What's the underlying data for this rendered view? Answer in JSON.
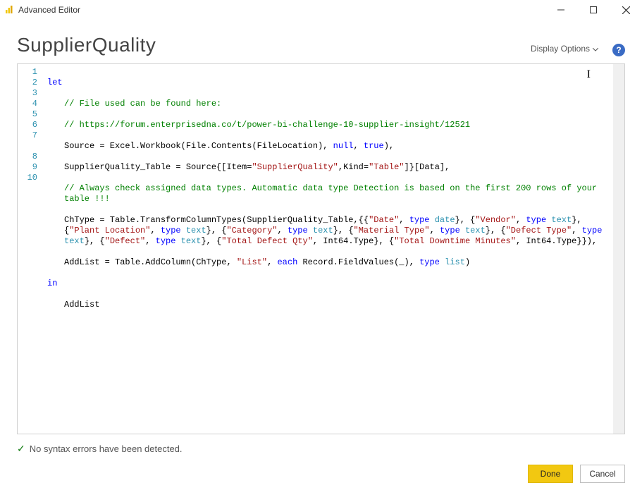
{
  "titlebar": {
    "title": "Advanced Editor"
  },
  "header": {
    "query_name": "SupplierQuality",
    "display_options": "Display Options",
    "help_glyph": "?"
  },
  "editor": {
    "line_numbers": [
      "1",
      "2",
      "3",
      "4",
      "5",
      "6",
      "7",
      "",
      "8",
      "9",
      "10"
    ],
    "code": {
      "l1_let": "let",
      "l2": "// File used can be found here:",
      "l3": "// https://forum.enterprisedna.co/t/power-bi-challenge-10-supplier-insight/12521",
      "l4_a": "Source = Excel.Workbook(File.Contents(FileLocation), ",
      "l4_null": "null",
      "l4_b": ", ",
      "l4_true": "true",
      "l4_c": "),",
      "l5_a": "SupplierQuality_Table = Source{[Item=",
      "l5_str1": "\"SupplierQuality\"",
      "l5_b": ",Kind=",
      "l5_str2": "\"Table\"",
      "l5_c": "]}[Data],",
      "l6": "// Always check assigned data types. Automatic data type Detection is based on the first 200 rows of your table !!!",
      "l7_a": "ChType = Table.TransformColumnTypes(SupplierQuality_Table,{{",
      "s_date": "\"Date\"",
      "sep": ", ",
      "t_type": "type",
      "t_date": " date",
      "brcl": "}, {",
      "s_vendor": "\"Vendor\"",
      "t_text": " text",
      "s_plant": "\"Plant Location\"",
      "s_category": "\"Category\"",
      "s_material": "\"Material Type\"",
      "s_deftype": "\"Defect Type\"",
      "s_defect": "\"Defect\"",
      "s_totaldq": "\"Total Defect Qty\"",
      "int64": ", Int64.Type}, {",
      "s_totaldt": "\"Total Downtime Minutes\"",
      "l7_end": ", Int64.Type}}),",
      "l8_a": "AddList = Table.AddColumn(ChType, ",
      "s_list": "\"List\"",
      "l8_b": ", ",
      "l8_each": "each",
      "l8_c": " Record.FieldValues(_), ",
      "t_list": " list",
      "l8_d": ")",
      "l9_in": "in",
      "l10": "AddList"
    },
    "caret_char": "I"
  },
  "status": {
    "check": "✓",
    "message": "No syntax errors have been detected."
  },
  "footer": {
    "done": "Done",
    "cancel": "Cancel"
  }
}
